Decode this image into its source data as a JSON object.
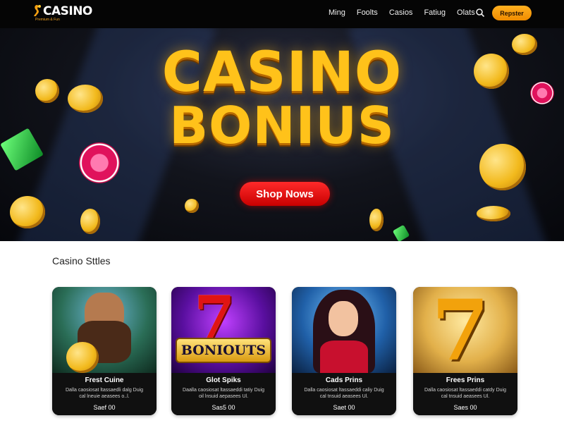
{
  "nav": {
    "logo_text": "CASINO",
    "logo_tagline": "Premium & Fun",
    "menu": [
      "Ming",
      "Foolts",
      "Casios",
      "Fatiug",
      "Olats"
    ],
    "cta_label": "Repster",
    "search_icon": "search-icon"
  },
  "hero": {
    "title_line1": "CASINO",
    "title_line2": "BONIUS",
    "button_label": "Shop Nows"
  },
  "section": {
    "title": "Casino Sttles"
  },
  "cards": [
    {
      "title": "Frest Cuine",
      "desc": "Dalla caosiosat ltassaedli dalg Duig cal lneuie aeasees o..l.",
      "price": "Saef 00"
    },
    {
      "title": "Glot Spiks",
      "desc": "Daalla caosiosat ltassaeddi tatiy Duig oil lnsuid aepasees Ul.",
      "price": "Sas5 00"
    },
    {
      "title": "Cads Prins",
      "desc": "Dalla caosiosat ltassaeddi caliy Duig cal tnsuid aeasees Ul.",
      "price": "Saet 00"
    },
    {
      "title": "Frees Prins",
      "desc": "Dalla caosiosat ltassaeddi catdy Duig cal tnsuid aeasees Ul.",
      "price": "Saes 00"
    }
  ],
  "card2_banner": "BONIOUTS",
  "colors": {
    "accent": "#ff9f0a",
    "hero_button": "#e00b0b",
    "gold": "#ffc21a"
  }
}
